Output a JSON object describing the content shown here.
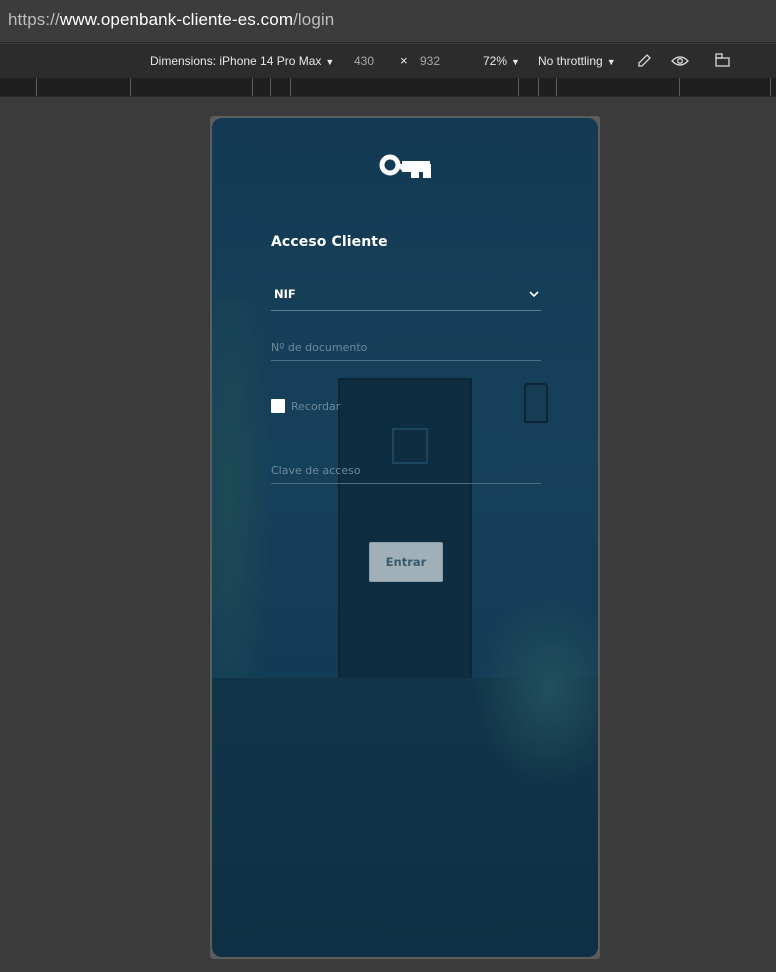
{
  "browser": {
    "url_scheme": "https://",
    "url_host": "www.openbank-cliente-es.com",
    "url_path": "/login"
  },
  "devtools": {
    "dimensions_label": "Dimensions: iPhone 14 Pro Max",
    "width": "430",
    "times": "×",
    "height": "932",
    "zoom": "72%",
    "throttling": "No throttling",
    "caret": "▼"
  },
  "form": {
    "title": "Acceso Cliente",
    "document_type": "NIF",
    "document_placeholder": "Nº de documento",
    "remember_label": "Recordar",
    "password_placeholder": "Clave de acceso",
    "submit_label": "Entrar"
  },
  "icons": {
    "logo": "key-logo-icon",
    "chevron": "chevron-down-icon",
    "picker": "color-picker-icon",
    "eye": "eye-icon",
    "rotate": "rotate-device-icon"
  }
}
